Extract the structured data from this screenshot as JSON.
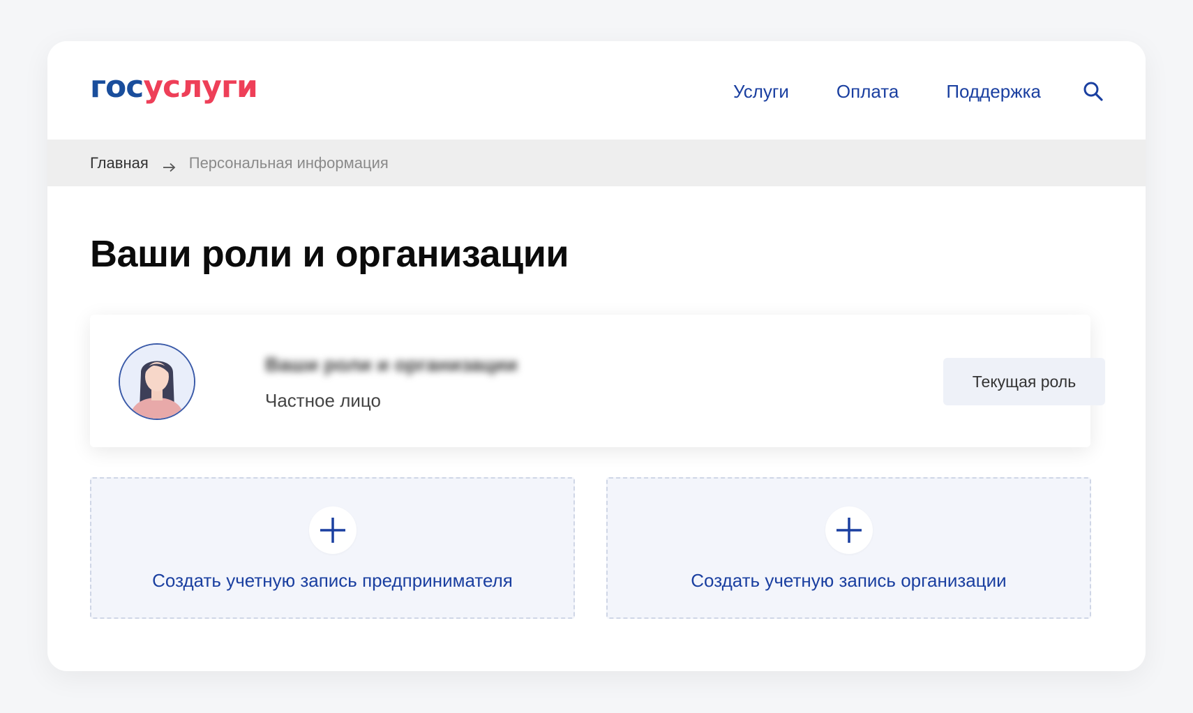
{
  "header": {
    "logo": {
      "part1": "гос",
      "part2": "услуги"
    },
    "nav": [
      {
        "label": "Услуги"
      },
      {
        "label": "Оплата"
      },
      {
        "label": "Поддержка"
      }
    ],
    "search_icon": "search-icon"
  },
  "breadcrumb": {
    "home": "Главная",
    "current": "Персональная информация",
    "separator_icon": "arrow-right-icon"
  },
  "main": {
    "title": "Ваши роли и организации",
    "role_card": {
      "name_blurred": "Ваши роли и организации",
      "role_type": "Частное лицо",
      "button_label": "Текущая роль",
      "avatar_icon": "user-avatar-icon"
    },
    "create_cards": [
      {
        "label": "Создать учетную запись предпринимателя",
        "icon": "plus-icon"
      },
      {
        "label": "Создать учетную запись организации",
        "icon": "plus-icon"
      }
    ]
  },
  "colors": {
    "brand_blue": "#1a4e9c",
    "brand_red": "#ee3f58",
    "link_blue": "#1a3fa0",
    "breadcrumb_bg": "#eeeeee",
    "create_card_bg": "#f3f5fb"
  }
}
